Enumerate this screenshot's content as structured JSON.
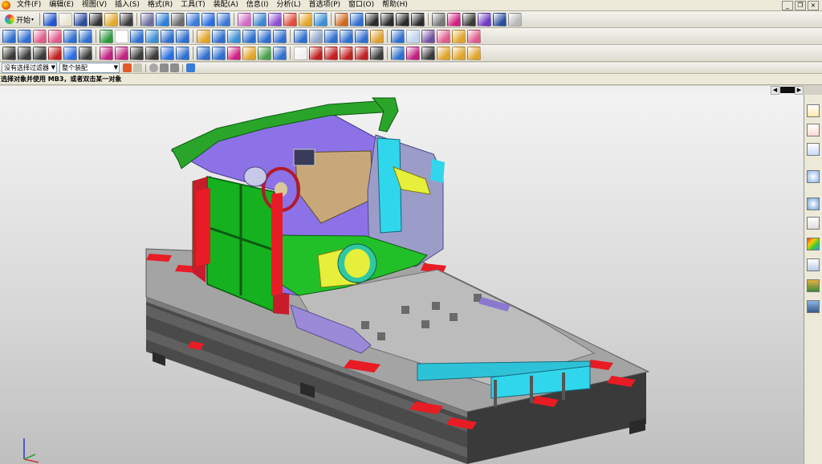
{
  "menubar": {
    "items": [
      "文件(F)",
      "编辑(E)",
      "视图(V)",
      "插入(S)",
      "格式(R)",
      "工具(T)",
      "装配(A)",
      "信息(I)",
      "分析(L)",
      "首选项(P)",
      "窗口(O)",
      "帮助(H)"
    ]
  },
  "toolbar": {
    "start_label": "开始",
    "row1": [
      "#2255cc",
      "#e8e4d0",
      "#2a4c9c",
      "#333333",
      "#e2ab2e",
      "#3a3a3a",
      "#6f6f9f",
      "#2d7fd6",
      "#6a6a6a",
      "#3b78d8",
      "#2a6ee0",
      "#3b78d8",
      "#d26ac8",
      "#3e86d0",
      "#8f4fd2",
      "#e14a3c",
      "#e1a52a",
      "#3a8ed4",
      "#d06a20",
      "#2f6fcf",
      "#2a2a2a",
      "#2a2a2a",
      "#2a2a2a",
      "#2a2a2a",
      "#777777",
      "#d02080",
      "#3a3a3a",
      "#6c3ac6",
      "#2a4c9c",
      "#b8b8b8"
    ],
    "row2": [
      "#2f6fcf",
      "#2f6fcf",
      "#e05a8a",
      "#e05a8a",
      "#2f6fcf",
      "#2f6fcf",
      "#2a9a3c",
      "#ffffff",
      "#2f6fcf",
      "#3a8ed4",
      "#2f6fcf",
      "#2f6fcf",
      "#e1a52a",
      "#2f6fcf",
      "#3a8ed4",
      "#2f6fcf",
      "#2f6fcf",
      "#2f6fcf",
      "#2f6fcf",
      "#8fa6c6",
      "#2f6fcf",
      "#2f6fcf",
      "#2f6fcf",
      "#e0a030",
      "#2f6fcf",
      "#c0d4ee",
      "#7050a0",
      "#e05a8a",
      "#e1a52a",
      "#e05a8a"
    ],
    "row3": [
      "#3a3a3a",
      "#3a3a3a",
      "#3a3a3a",
      "#c02020",
      "#2a6ee0",
      "#3a3a3a",
      "#c02080",
      "#c02080",
      "#3a3a3a",
      "#3a3a3a",
      "#2a6ee0",
      "#2f6fcf",
      "#2f6fcf",
      "#2f6fcf",
      "#d02080",
      "#e1a52a",
      "#4aa04a",
      "#2f6fcf",
      "#f0f0f0",
      "#c02020",
      "#c02020",
      "#c02020",
      "#c02020",
      "#3a3a3a",
      "#2f6fcf",
      "#c02080",
      "#3a3a3a",
      "#e1a52a",
      "#e1a52a",
      "#e1a52a"
    ]
  },
  "selection": {
    "filter_value": "没有选择过滤器",
    "scope_value": "整个装配"
  },
  "cue_line": "选择对象并使用 MB3，或者双击某一对象",
  "colors": {
    "fixture_frame": "#505050",
    "base_plate": "#a4a4a4",
    "red_pads": "#e81c24",
    "support_panels": "#15b11f",
    "dashboard": "#8c72e6",
    "bracket": "#2aa52a",
    "yellow_parts": "#e6ef3a",
    "cyan_parts": "#30d6ec"
  }
}
